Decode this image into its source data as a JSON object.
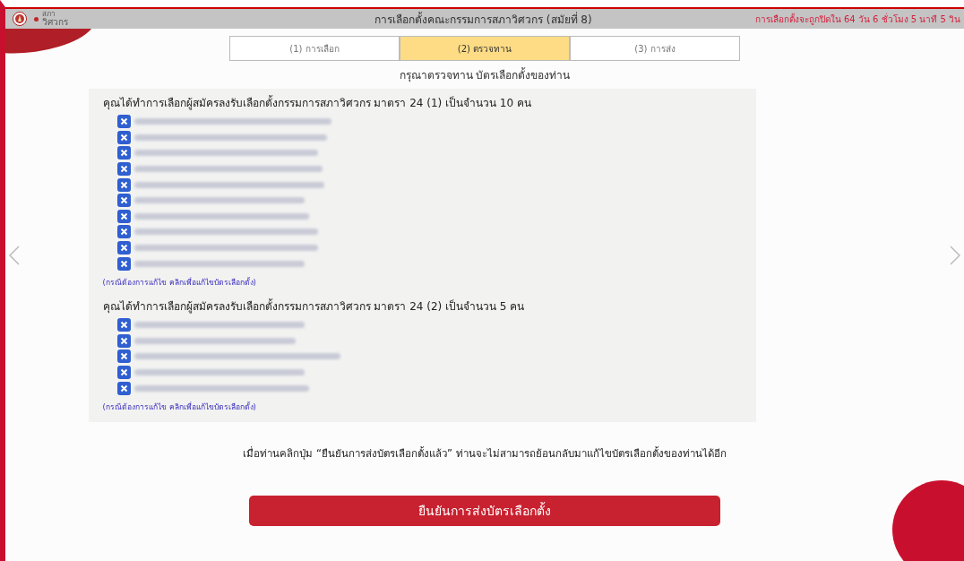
{
  "header": {
    "logo_small": "สภา",
    "logo_text": "วิศวกร",
    "title": "การเลือกตั้งคณะกรรมการสภาวิศวกร (สมัยที่ 8)",
    "countdown": "การเลือกตั้งจะถูกปิดใน 64 วัน 6 ชั่วโมง 5 นาที 5 วิน"
  },
  "steps": [
    {
      "label": "(1) การเลือก",
      "selected": false
    },
    {
      "label": "(2) ตรวจทาน",
      "selected": true
    },
    {
      "label": "(3) การส่ง",
      "selected": false
    }
  ],
  "instruction": "กรุณาตรวจทาน บัตรเลือกตั้งของท่าน",
  "sections": [
    {
      "heading": "คุณได้ทำการเลือกผู้สมัครลงรับเลือกตั้งกรรมการสภาวิศวกร มาตรา 24 (1) เป็นจำนวน 10 คน",
      "candidates": [
        {
          "checked": true
        },
        {
          "checked": true
        },
        {
          "checked": true
        },
        {
          "checked": true
        },
        {
          "checked": true
        },
        {
          "checked": true
        },
        {
          "checked": true
        },
        {
          "checked": true
        },
        {
          "checked": true
        },
        {
          "checked": true
        }
      ],
      "edit_link": "(กรณีต้องการแก้ไข คลิกเพื่อแก้ไขบัตรเลือกตั้ง)"
    },
    {
      "heading": "คุณได้ทำการเลือกผู้สมัครลงรับเลือกตั้งกรรมการสภาวิศวกร มาตรา 24 (2) เป็นจำนวน 5 คน",
      "candidates": [
        {
          "checked": true
        },
        {
          "checked": true
        },
        {
          "checked": true
        },
        {
          "checked": true
        },
        {
          "checked": true
        }
      ],
      "edit_link": "(กรณีต้องการแก้ไข คลิกเพื่อแก้ไขบัตรเลือกตั้ง)"
    }
  ],
  "warning": "เมื่อท่านคลิกปุ่ม “ยืนยันการส่งบัตรเลือกตั้งแล้ว” ท่านจะไม่สามารถย้อนกลับมาแก้ไขบัตรเลือกตั้งของท่านได้อีก",
  "confirm_button": "ยืนยันการส่งบัตรเลือกตั้ง"
}
